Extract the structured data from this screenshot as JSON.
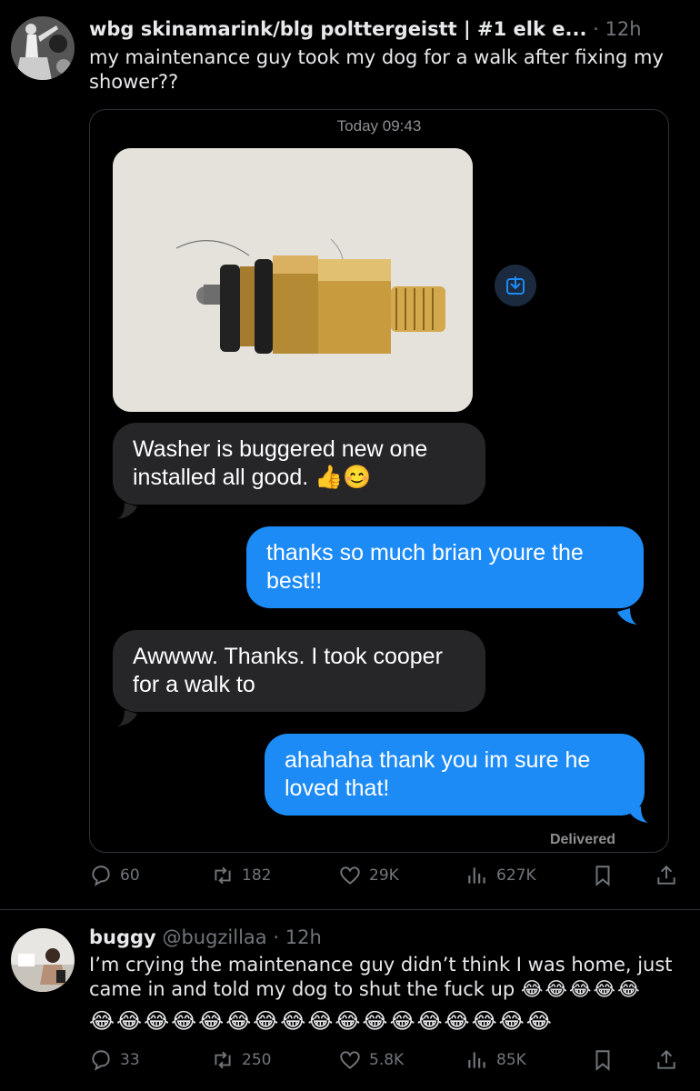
{
  "tweet1": {
    "name": "wbg skinamarink/blg polttergeistt | #1 elk e...",
    "sep": "·",
    "time": "12h",
    "text": "my maintenance guy took my dog for a walk after fixing my shower??",
    "screenshot": {
      "timestamp": "Today 09:43",
      "messages": [
        {
          "side": "in",
          "text": "Washer is buggered new one installed all good. 👍😊"
        },
        {
          "side": "out",
          "text": "thanks so much brian youre the best!!"
        },
        {
          "side": "in",
          "text": "Awwww. Thanks. I took cooper for a walk to"
        },
        {
          "side": "out",
          "text": "ahahaha thank you im sure he loved that!"
        }
      ],
      "status": "Delivered"
    },
    "actions": {
      "replies": "60",
      "retweets": "182",
      "likes": "29K",
      "views": "627K"
    }
  },
  "tweet2": {
    "name": "buggy",
    "handle": "@bugzillaa",
    "sep": "·",
    "time": "12h",
    "text": "I’m crying the maintenance guy didn’t think I was home, just came in and told my dog to shut the fuck up",
    "emoji_line1": "😂😂😂😂😂",
    "emoji_line2": "😂😂😂😂😂😂😂😂😂😂😂😂😂😂😂😂😂",
    "actions": {
      "replies": "33",
      "retweets": "250",
      "likes": "5.8K",
      "views": "85K"
    }
  },
  "icons": [
    "reply-icon",
    "retweet-icon",
    "like-icon",
    "views-icon",
    "bookmark-icon",
    "share-icon",
    "save-image-icon"
  ],
  "colors": {
    "background": "#000000",
    "secondary": "#71767b",
    "outgoing_bubble": "#1d8bf6",
    "incoming_bubble": "#262628",
    "divider": "#2f3336"
  }
}
